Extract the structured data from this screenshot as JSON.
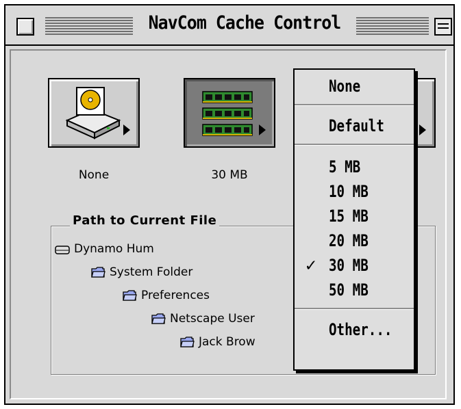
{
  "window": {
    "title": "NavCom Cache Control"
  },
  "buttons": [
    {
      "caption": "None",
      "icon": "hard-drive-icon"
    },
    {
      "caption": "30 MB",
      "icon": "memory-chips-icon"
    }
  ],
  "path_group": {
    "label": "Path to Current File",
    "items": [
      {
        "label": "Dynamo Hum",
        "icon": "disk-icon"
      },
      {
        "label": "System Folder",
        "icon": "folder-icon"
      },
      {
        "label": "Preferences",
        "icon": "folder-icon"
      },
      {
        "label": "Netscape User",
        "icon": "folder-icon"
      },
      {
        "label": "Jack Brow",
        "icon": "folder-icon"
      }
    ]
  },
  "menu": {
    "items": [
      {
        "label": "None"
      },
      {
        "label": "Default"
      },
      {
        "label": "5 MB"
      },
      {
        "label": "10 MB"
      },
      {
        "label": "15 MB"
      },
      {
        "label": "20 MB"
      },
      {
        "label": "30 MB",
        "checked": true
      },
      {
        "label": "50 MB"
      },
      {
        "label": "Other..."
      }
    ],
    "check_mark": "✓"
  }
}
